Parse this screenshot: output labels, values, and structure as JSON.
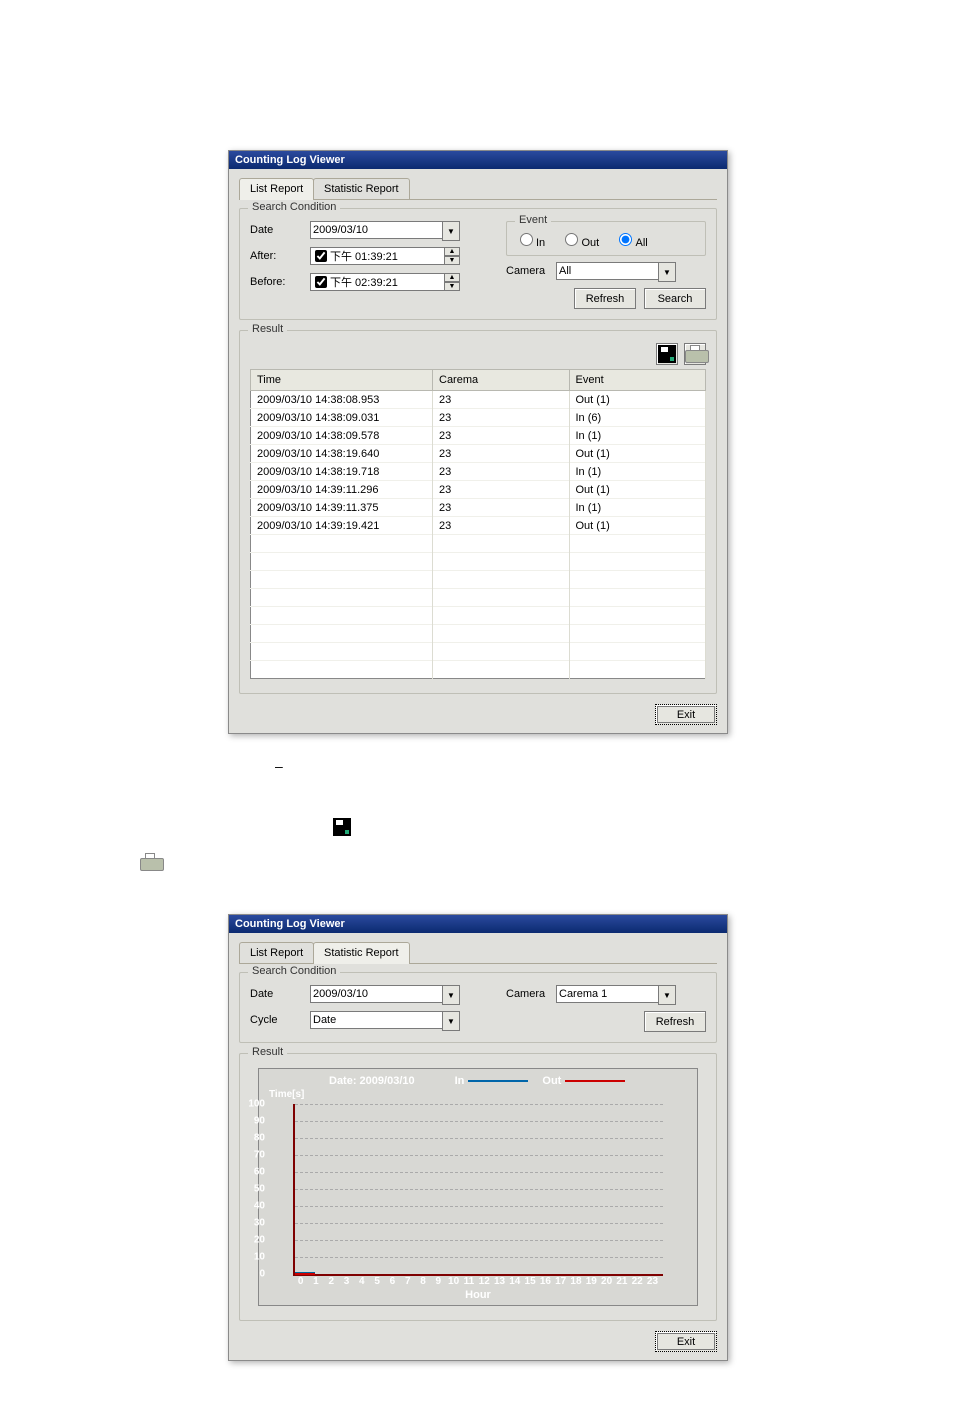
{
  "window_title": "Counting Log Viewer",
  "tabs": [
    "List Report",
    "Statistic Report"
  ],
  "list_report": {
    "groups": {
      "search": "Search Condition",
      "event": "Event",
      "result": "Result"
    },
    "labels": {
      "date": "Date",
      "after": "After:",
      "before": "Before:",
      "camera": "Camera"
    },
    "date_value": "2009/03/10",
    "after_value": "下午 01:39:21",
    "before_value": "下午 02:39:21",
    "event_options": {
      "in": "In",
      "out": "Out",
      "all": "All"
    },
    "event_selected": "All",
    "camera_value": "All",
    "buttons": {
      "refresh": "Refresh",
      "search": "Search",
      "exit": "Exit"
    },
    "table": {
      "headers": [
        "Time",
        "Carema",
        "Event"
      ],
      "rows": [
        [
          "2009/03/10 14:38:08.953",
          "23",
          "Out (1)"
        ],
        [
          "2009/03/10 14:38:09.031",
          "23",
          "In (6)"
        ],
        [
          "2009/03/10 14:38:09.578",
          "23",
          "In (1)"
        ],
        [
          "2009/03/10 14:38:19.640",
          "23",
          "Out (1)"
        ],
        [
          "2009/03/10 14:38:19.718",
          "23",
          "In (1)"
        ],
        [
          "2009/03/10 14:39:11.296",
          "23",
          "Out (1)"
        ],
        [
          "2009/03/10 14:39:11.375",
          "23",
          "In (1)"
        ],
        [
          "2009/03/10 14:39:19.421",
          "23",
          "Out (1)"
        ]
      ]
    }
  },
  "dash": "–",
  "statistic_report": {
    "groups": {
      "search": "Search Condition",
      "result": "Result"
    },
    "labels": {
      "date": "Date",
      "cycle": "Cycle",
      "camera": "Camera"
    },
    "date_value": "2009/03/10",
    "cycle_value": "Date",
    "camera_value": "Carema 1",
    "buttons": {
      "refresh": "Refresh",
      "exit": "Exit"
    }
  },
  "chart_data": {
    "type": "line",
    "title": "Date: 2009/03/10",
    "legend": [
      "In",
      "Out"
    ],
    "legend_colors": [
      "#0066aa",
      "#cc0000"
    ],
    "xlabel": "Hour",
    "ylabel": "Time[s]",
    "x": [
      0,
      1,
      2,
      3,
      4,
      5,
      6,
      7,
      8,
      9,
      10,
      11,
      12,
      13,
      14,
      15,
      16,
      17,
      18,
      19,
      20,
      21,
      22,
      23
    ],
    "ylim": [
      0,
      100
    ],
    "yticks": [
      0,
      10,
      20,
      30,
      40,
      50,
      60,
      70,
      80,
      90,
      100
    ],
    "series": [
      {
        "name": "In",
        "values": [
          0,
          0,
          0,
          0,
          0,
          0,
          0,
          0,
          0,
          0,
          0,
          0,
          0,
          0,
          0,
          0,
          0,
          0,
          0,
          0,
          0,
          0,
          0,
          0
        ]
      },
      {
        "name": "Out",
        "values": [
          0,
          0,
          0,
          0,
          0,
          0,
          0,
          0,
          0,
          0,
          0,
          0,
          0,
          0,
          0,
          0,
          0,
          0,
          0,
          0,
          0,
          0,
          0,
          0
        ]
      }
    ]
  }
}
